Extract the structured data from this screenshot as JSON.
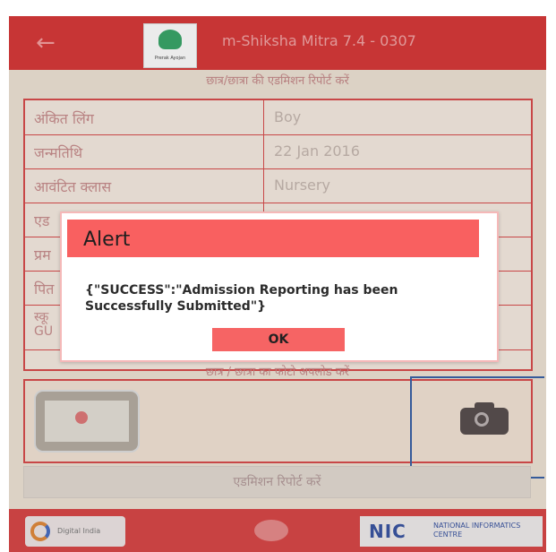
{
  "appbar": {
    "title": "m-Shiksha Mitra 7.4 - 0307",
    "logo_caption": "Prerak Ayojan"
  },
  "section": {
    "title": "छात्र/छात्रा की एडमिशन रिपोर्ट करें"
  },
  "table": {
    "rows": [
      {
        "label": "अंकित लिंग",
        "value": "Boy"
      },
      {
        "label": "जन्मतिथि",
        "value": "22 Jan 2016"
      },
      {
        "label": "आवंटित क्लास",
        "value": "Nursery"
      },
      {
        "label": "एड",
        "value": ""
      },
      {
        "label": "प्रम",
        "value": ""
      },
      {
        "label": "पित",
        "value": ""
      }
    ],
    "school_row": {
      "label": "स्कू\nGU",
      "value": ""
    }
  },
  "photo_section": {
    "title": "छात्र / छात्रा का फोटो अपलोड करें"
  },
  "submit": {
    "label": "एडमिशन रिपोर्ट करें"
  },
  "footer": {
    "digital_india_text": "Digital India",
    "nic_text": "NIC",
    "nic_subtext": "NATIONAL INFORMATICS CENTRE"
  },
  "dialog": {
    "title": "Alert",
    "message": "{\"SUCCESS\":\"Admission Reporting has been Successfully Submitted\"}",
    "ok_label": "OK"
  },
  "colors": {
    "appbar": "#d83a3a",
    "dialog_header": "#f96060",
    "highlight_frame": "#3b63a8"
  }
}
